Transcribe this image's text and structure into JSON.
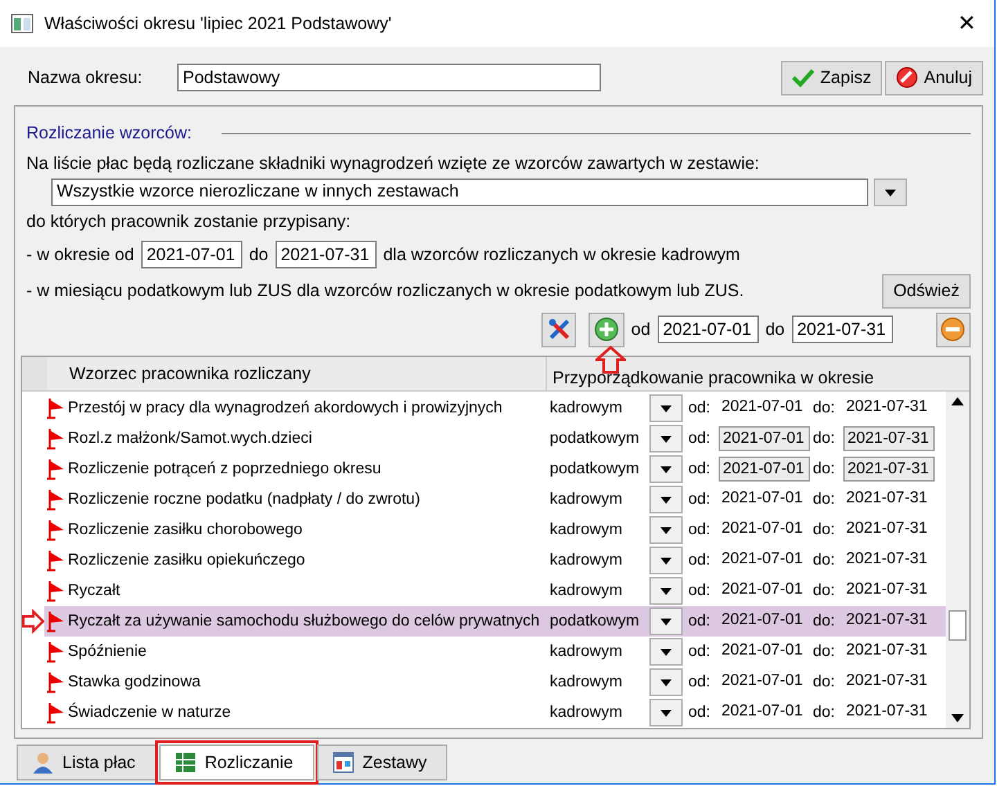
{
  "window": {
    "title": "Właściwości okresu 'lipiec 2021 Podstawowy'",
    "close": "✕"
  },
  "name_field": {
    "label": "Nazwa okresu:",
    "value": "Podstawowy"
  },
  "buttons": [
    {
      "label": "Zapisz",
      "kind": "save"
    },
    {
      "label": "Anuluj",
      "kind": "cancel"
    }
  ],
  "group": {
    "title": "Rozliczanie wzorców:",
    "intro": "Na liście płac będą rozliczane składniki wynagrodzeń wzięte ze wzorców zawartych w zestawie:",
    "set_dropdown": {
      "value": "Wszystkie wzorce nierozliczane w innych zestawach"
    },
    "assigned_text": "do których pracownik zostanie przypisany:",
    "period_prefix": "- w okresie od",
    "period_from": "2021-07-01",
    "period_to_label": "do",
    "period_to": "2021-07-31",
    "period_suffix": "dla wzorców rozliczanych w okresie kadrowym",
    "tax_text": "- w miesiącu podatkowym lub ZUS dla wzorców rozliczanych w okresie podatkowym lub ZUS.",
    "refresh": "Odśwież",
    "toolbar": {
      "from_label": "od",
      "from": "2021-07-01",
      "to_label": "do",
      "to": "2021-07-31"
    }
  },
  "table": {
    "columns": [
      "Wzorzec pracownika rozliczany",
      "Przyporządkowanie pracownika w okresie"
    ],
    "rows": [
      {
        "name": "Przestój w pracy dla wynagrodzeń akordowych i prowizyjnych",
        "type": "kadrowym",
        "from_label": "od:",
        "from": "2021-07-01",
        "to_label": "do:",
        "to": "2021-07-31",
        "boxed": false,
        "selected": false
      },
      {
        "name": "Rozl.z małżonk/Samot.wych.dzieci",
        "type": "podatkowym",
        "from_label": "od:",
        "from": "2021-07-01",
        "to_label": "do:",
        "to": "2021-07-31",
        "boxed": true,
        "selected": false
      },
      {
        "name": "Rozliczenie potrąceń z poprzedniego okresu",
        "type": "podatkowym",
        "from_label": "od:",
        "from": "2021-07-01",
        "to_label": "do:",
        "to": "2021-07-31",
        "boxed": true,
        "selected": false
      },
      {
        "name": "Rozliczenie roczne podatku (nadpłaty / do zwrotu)",
        "type": "kadrowym",
        "from_label": "od:",
        "from": "2021-07-01",
        "to_label": "do:",
        "to": "2021-07-31",
        "boxed": false,
        "selected": false
      },
      {
        "name": "Rozliczenie zasiłku chorobowego",
        "type": "kadrowym",
        "from_label": "od:",
        "from": "2021-07-01",
        "to_label": "do:",
        "to": "2021-07-31",
        "boxed": false,
        "selected": false
      },
      {
        "name": "Rozliczenie zasiłku opiekuńczego",
        "type": "kadrowym",
        "from_label": "od:",
        "from": "2021-07-01",
        "to_label": "do:",
        "to": "2021-07-31",
        "boxed": false,
        "selected": false
      },
      {
        "name": "Ryczałt",
        "type": "kadrowym",
        "from_label": "od:",
        "from": "2021-07-01",
        "to_label": "do:",
        "to": "2021-07-31",
        "boxed": false,
        "selected": false
      },
      {
        "name": "Ryczałt za używanie samochodu służbowego do celów prywatnych",
        "type": "podatkowym",
        "from_label": "od:",
        "from": "2021-07-01",
        "to_label": "do:",
        "to": "2021-07-31",
        "boxed": false,
        "selected": true
      },
      {
        "name": "Spóźnienie",
        "type": "kadrowym",
        "from_label": "od:",
        "from": "2021-07-01",
        "to_label": "do:",
        "to": "2021-07-31",
        "boxed": false,
        "selected": false
      },
      {
        "name": "Stawka godzinowa",
        "type": "kadrowym",
        "from_label": "od:",
        "from": "2021-07-01",
        "to_label": "do:",
        "to": "2021-07-31",
        "boxed": false,
        "selected": false
      },
      {
        "name": "Świadczenie w naturze",
        "type": "kadrowym",
        "from_label": "od:",
        "from": "2021-07-01",
        "to_label": "do:",
        "to": "2021-07-31",
        "boxed": false,
        "selected": false
      }
    ]
  },
  "tabs": [
    {
      "label": "Lista płac",
      "kind": "person",
      "selected": false
    },
    {
      "label": "Rozliczanie",
      "kind": "sheet",
      "selected": true
    },
    {
      "label": "Zestawy",
      "kind": "sets",
      "selected": false
    }
  ]
}
